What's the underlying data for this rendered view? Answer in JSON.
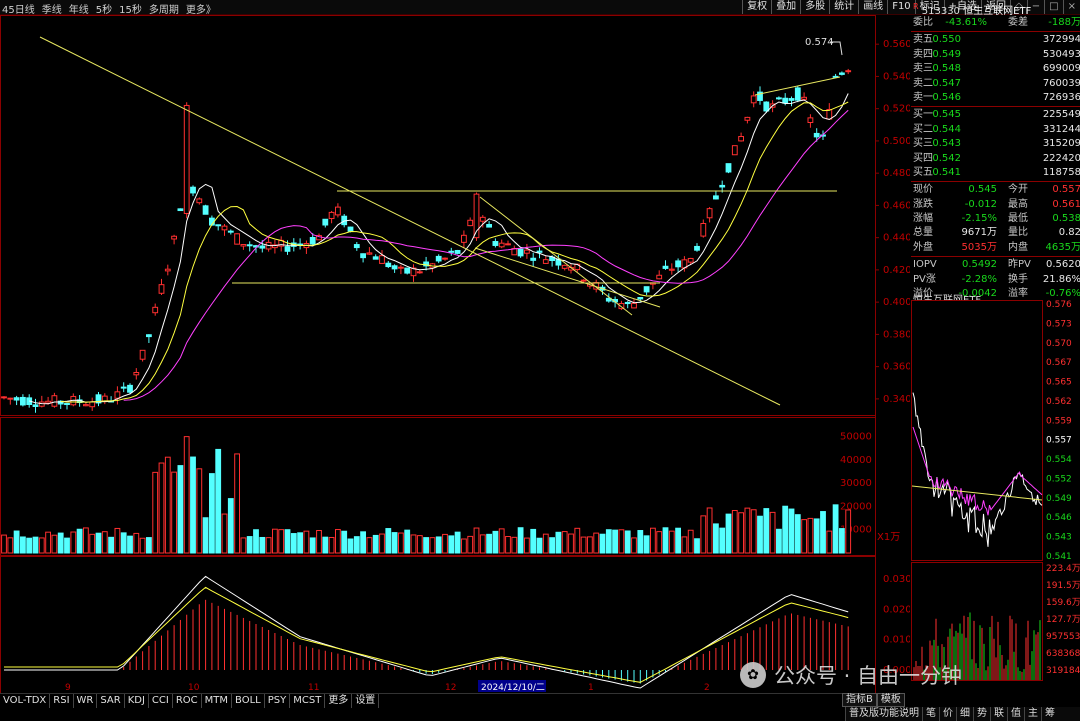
{
  "toolbar": {
    "left": [
      "45日线",
      "季线",
      "年线",
      "5秒",
      "15秒",
      "多周期",
      "更多》"
    ],
    "right": [
      "复权",
      "叠加",
      "多股",
      "统计",
      "画线",
      "F10",
      "标记",
      "+自选",
      "返回"
    ]
  },
  "product": {
    "code": "513330",
    "name": "恒生互联网ETF",
    "badge": "R"
  },
  "quote": {
    "webi": {
      "label": "委比",
      "value": "-43.61%",
      "label2": "委差",
      "value2": "-188万"
    },
    "asks": [
      {
        "label": "卖五",
        "price": "0.550",
        "vol": "372994"
      },
      {
        "label": "卖四",
        "price": "0.549",
        "vol": "530493"
      },
      {
        "label": "卖三",
        "price": "0.548",
        "vol": "699009"
      },
      {
        "label": "卖二",
        "price": "0.547",
        "vol": "760039"
      },
      {
        "label": "卖一",
        "price": "0.546",
        "vol": "726936"
      }
    ],
    "bids": [
      {
        "label": "买一",
        "price": "0.545",
        "vol": "225549"
      },
      {
        "label": "买二",
        "price": "0.544",
        "vol": "331244"
      },
      {
        "label": "买三",
        "price": "0.543",
        "vol": "315209"
      },
      {
        "label": "买四",
        "price": "0.542",
        "vol": "222420"
      },
      {
        "label": "买五",
        "price": "0.541",
        "vol": "118758"
      }
    ],
    "stats": [
      {
        "l1": "现价",
        "v1": "0.545",
        "l2": "今开",
        "v2": "0.557"
      },
      {
        "l1": "涨跌",
        "v1": "-0.012",
        "l2": "最高",
        "v2": "0.561"
      },
      {
        "l1": "涨幅",
        "v1": "-2.15%",
        "l2": "最低",
        "v2": "0.538"
      },
      {
        "l1": "总量",
        "v1": "9671万",
        "l2": "量比",
        "v2": "0.82"
      },
      {
        "l1": "外盘",
        "v1": "5035万",
        "l2": "内盘",
        "v2": "4635万"
      }
    ],
    "iopv": [
      {
        "l1": "IOPV",
        "v1": "0.5492",
        "l2": "昨PV",
        "v2": "0.5620"
      },
      {
        "l1": "PV涨",
        "v1": "-2.28%",
        "l2": "换手",
        "v2": "21.86%"
      },
      {
        "l1": "溢价",
        "v1": "-0.0042",
        "l2": "溢率",
        "v2": "-0.76%"
      }
    ]
  },
  "intraday": {
    "title": "恒生互联网ETF",
    "price_ticks": [
      "0.576",
      "0.573",
      "0.570",
      "0.567",
      "0.565",
      "0.562",
      "0.559",
      "0.557",
      "0.554",
      "0.552",
      "0.549",
      "0.546",
      "0.543",
      "0.541"
    ],
    "vol_ticks": [
      "223.4万",
      "191.5万",
      "159.6万",
      "127.7万",
      "957553",
      "638368",
      "319184"
    ]
  },
  "main_chart": {
    "price_ticks": [
      "0.560",
      "0.540",
      "0.520",
      "0.500",
      "0.480",
      "0.460",
      "0.440",
      "0.420",
      "0.400",
      "0.380",
      "0.360",
      "0.340"
    ],
    "vol_ticks": [
      "50000",
      "40000",
      "30000",
      "20000",
      "10000"
    ],
    "vol_unit": "X1万",
    "macd_ticks": [
      "0.030",
      "0.020",
      "0.010",
      "0.000"
    ],
    "high_label": "0.574",
    "x_labels": [
      "9",
      "10",
      "11",
      "12",
      "1",
      "2"
    ],
    "cursor_date": "2024/12/10/二"
  },
  "tabs": [
    "VOL-TDX",
    "RSI",
    "WR",
    "SAR",
    "KDJ",
    "CCI",
    "ROC",
    "MTM",
    "BOLL",
    "PSY",
    "MCST",
    "更多",
    "设置"
  ],
  "right_tabs": [
    "指标B",
    "模板"
  ],
  "bottom_strip": [
    "普及版功能说明",
    "笔",
    "价",
    "细",
    "势",
    "联",
    "值",
    "主",
    "筹"
  ],
  "watermark": {
    "text": "公众号 · 自由一分钟"
  }
}
